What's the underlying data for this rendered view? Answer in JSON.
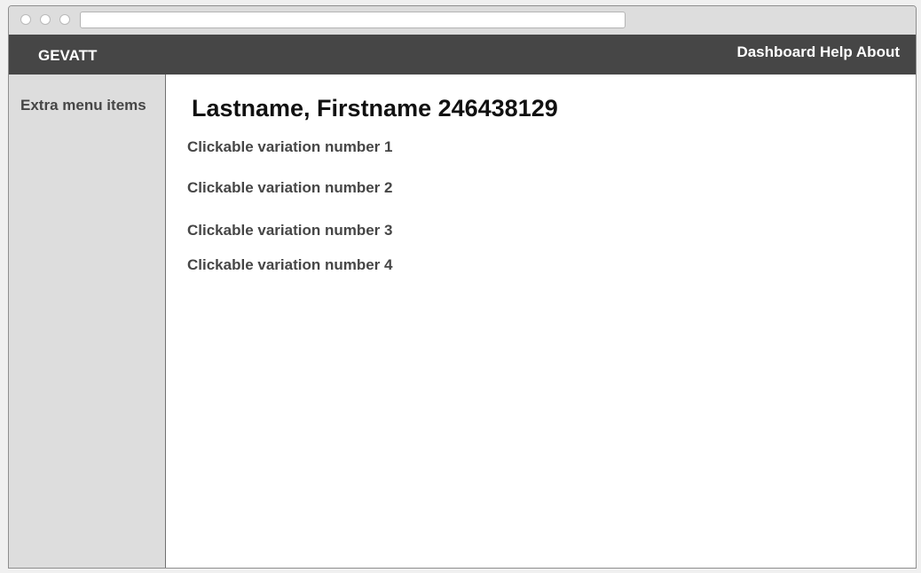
{
  "navbar": {
    "brand": "GEVATT",
    "links": [
      "Dashboard",
      "Help",
      "About"
    ]
  },
  "sidebar": {
    "items": [
      {
        "label": "Extra menu items"
      }
    ]
  },
  "main": {
    "title": "Lastname, Firstname 246438129",
    "variations": [
      {
        "label": "Clickable variation number 1"
      },
      {
        "label": "Clickable variation number 2"
      },
      {
        "label": "Clickable variation number 3"
      },
      {
        "label": "Clickable variation number 4"
      }
    ]
  },
  "colors": {
    "navbar_bg": "#464646",
    "sidebar_bg": "#dddddd",
    "link_text": "#464646"
  }
}
